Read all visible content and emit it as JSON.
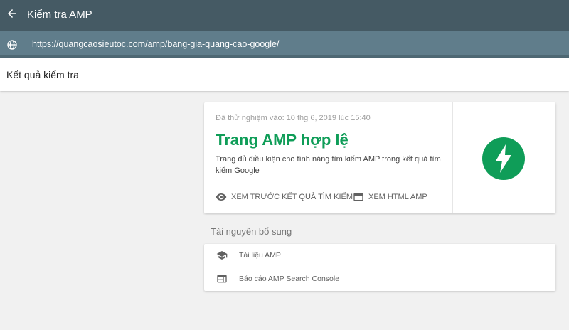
{
  "app": {
    "title": "Kiểm tra AMP",
    "url": "https://quangcaosieutoc.com/amp/bang-gia-quang-cao-google/"
  },
  "header": {
    "title": "Kết quả kiểm tra"
  },
  "result": {
    "tested_at": "Đã thử nghiệm vào: 10 thg 6, 2019 lúc 15:40",
    "status": "Trang AMP hợp lệ",
    "description": "Trang đủ điều kiện cho tính năng tìm kiếm AMP trong kết quả tìm kiếm Google",
    "actions": {
      "preview_label": "XEM TRƯỚC KẾT QUẢ TÌM KIẾM",
      "html_label": "XEM HTML AMP"
    }
  },
  "resources": {
    "title": "Tài nguyên bổ sung",
    "items": [
      {
        "label": "Tài liệu AMP",
        "icon": "school-icon"
      },
      {
        "label": "Báo cáo AMP Search Console",
        "icon": "web-icon"
      }
    ]
  },
  "colors": {
    "topbar": "#455a64",
    "urlbar": "#607d8b",
    "valid_green": "#0f9d58",
    "background": "#f1f1f1"
  }
}
